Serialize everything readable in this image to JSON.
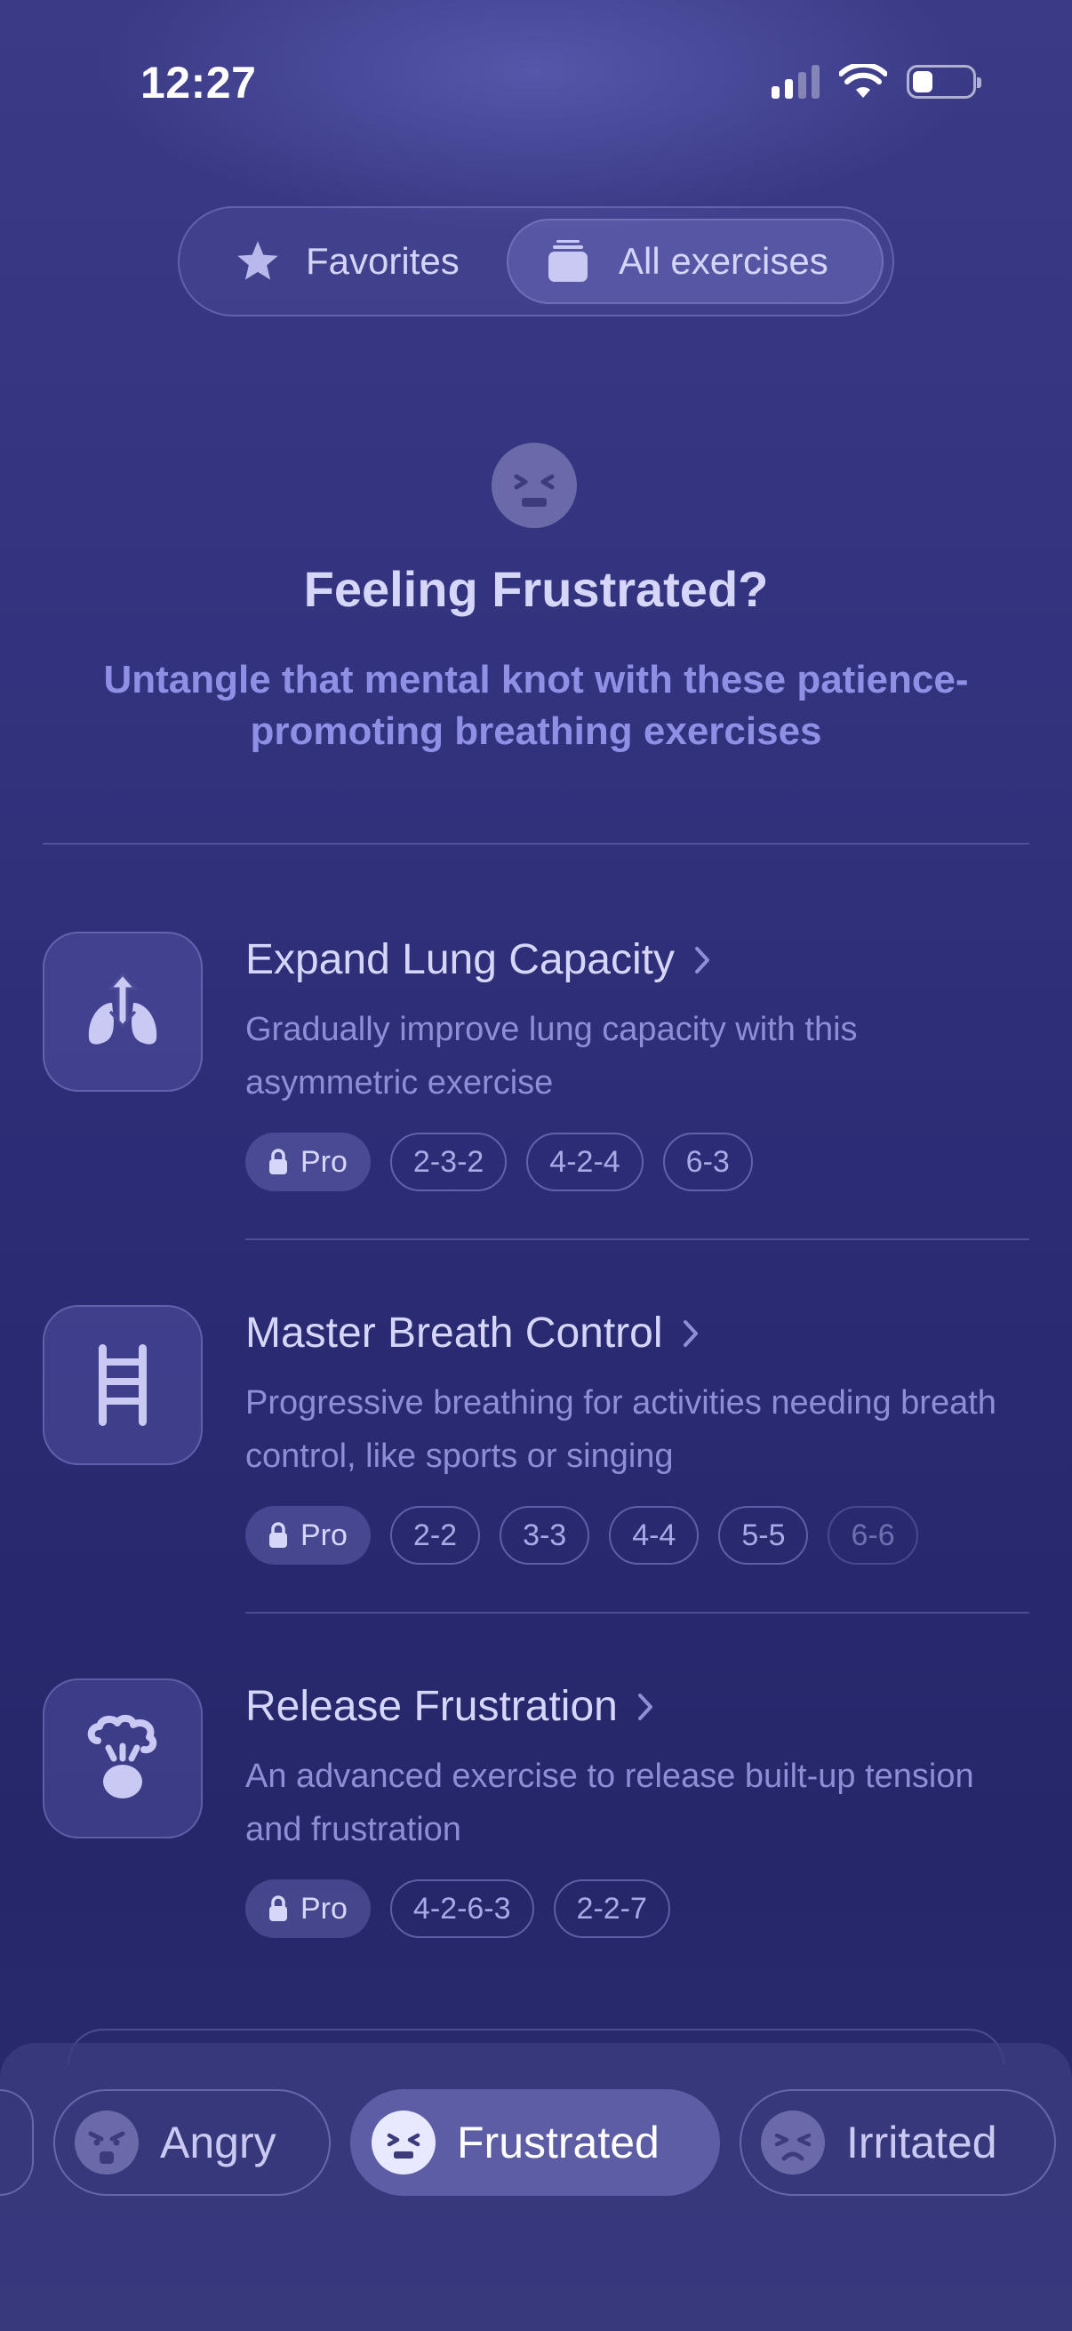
{
  "status_bar": {
    "time": "12:27"
  },
  "segmented": {
    "favorites_label": "Favorites",
    "all_label": "All exercises",
    "selected": "All exercises"
  },
  "hero": {
    "title": "Feeling Frustrated?",
    "subtitle": "Untangle that mental knot with these patience-promoting breathing exercises"
  },
  "exercises": [
    {
      "title": "Expand Lung Capacity",
      "description": "Gradually improve lung capacity with this asymmetric exercise",
      "icon": "lungs-icon",
      "pro_label": "Pro",
      "patterns": [
        "2-3-2",
        "4-2-4",
        "6-3"
      ]
    },
    {
      "title": "Master Breath Control",
      "description": "Progressive breathing for activities needing breath control, like sports or singing",
      "icon": "ladder-icon",
      "pro_label": "Pro",
      "patterns": [
        "2-2",
        "3-3",
        "4-4",
        "5-5",
        "6-6"
      ]
    },
    {
      "title": "Release Frustration",
      "description": "An advanced exercise to release built-up tension and frustration",
      "icon": "steam-head-icon",
      "pro_label": "Pro",
      "patterns": [
        "4-2-6-3",
        "2-2-7"
      ]
    }
  ],
  "moods": [
    {
      "label": "Angry",
      "icon": "angry-face-icon"
    },
    {
      "label": "Frustrated",
      "icon": "frustrated-face-icon",
      "selected": true
    },
    {
      "label": "Irritated",
      "icon": "irritated-face-icon"
    }
  ],
  "colors": {
    "background": "#2f2f7a",
    "accent_text": "#8f8fe6",
    "title_text": "#d6d6f8"
  }
}
